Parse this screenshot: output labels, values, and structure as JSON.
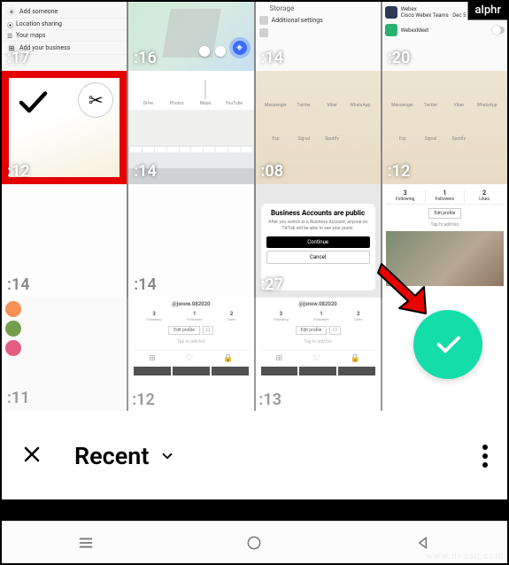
{
  "watermarks": {
    "alphr": "alphr",
    "deuaq": "www.deuaq.com"
  },
  "row0": {
    "c0": {
      "duration": ":17",
      "line1": "Add someone",
      "line2": "Location sharing",
      "line3": "Your maps",
      "line4": "Add your business"
    },
    "c1": {
      "duration": ":16"
    },
    "c2": {
      "duration": ":14",
      "header": "Storage",
      "item1": "Additional settings",
      "item2": ""
    },
    "c3": {
      "duration": ":20",
      "app1": "Webex",
      "app1_sub": "Cisco Webex Teams · Dec 5 at ...",
      "app2": "WebexMeet",
      "app2_sub": ""
    }
  },
  "row1": {
    "c0": {
      "duration": ":12"
    },
    "c1": {
      "duration": ":14",
      "apps": [
        "Drive",
        "Photos",
        "Maps",
        "YouTube"
      ]
    },
    "c2": {
      "duration": ":08",
      "apps": [
        "Messenger",
        "Twitter",
        "Viber",
        "WhatsApp",
        "Exp",
        "Signal",
        "Spotify",
        ""
      ]
    },
    "c3": {
      "duration": ":12",
      "apps": [
        "Messenger",
        "Twitter",
        "Viber",
        "WhatsApp",
        "Exp",
        "Signal",
        "Spotify",
        ""
      ]
    }
  },
  "row2": {
    "c0": {
      "duration": ":14"
    },
    "c1": {
      "duration": ":14"
    },
    "c2": {
      "duration": ":27",
      "title": "Business Accounts are public",
      "body": "After you switch to a Business Account, anyone on TikTok will be able to see your posts.",
      "primary": "Continue",
      "secondary": "Cancel"
    },
    "c3": {
      "stats": [
        {
          "n": "3",
          "l": "Following"
        },
        {
          "n": "1",
          "l": "Followers"
        },
        {
          "n": "2",
          "l": "Likes"
        }
      ],
      "edit": "Edit profile",
      "bio": "Tap to add bio"
    }
  },
  "row3": {
    "c0": {
      "duration": ":11"
    },
    "c1": {
      "duration": ":12",
      "user": "@jsnow.082020"
    },
    "c2": {
      "duration": ":13",
      "user": "@jsnow.082020"
    },
    "profile": {
      "stats": [
        {
          "n": "3",
          "l": "Following"
        },
        {
          "n": "1",
          "l": "Followers"
        },
        {
          "n": "2",
          "l": "Likes"
        }
      ],
      "edit": "Edit profile",
      "bio": "Tap to add bio"
    }
  },
  "toolbar": {
    "title": "Recent"
  }
}
